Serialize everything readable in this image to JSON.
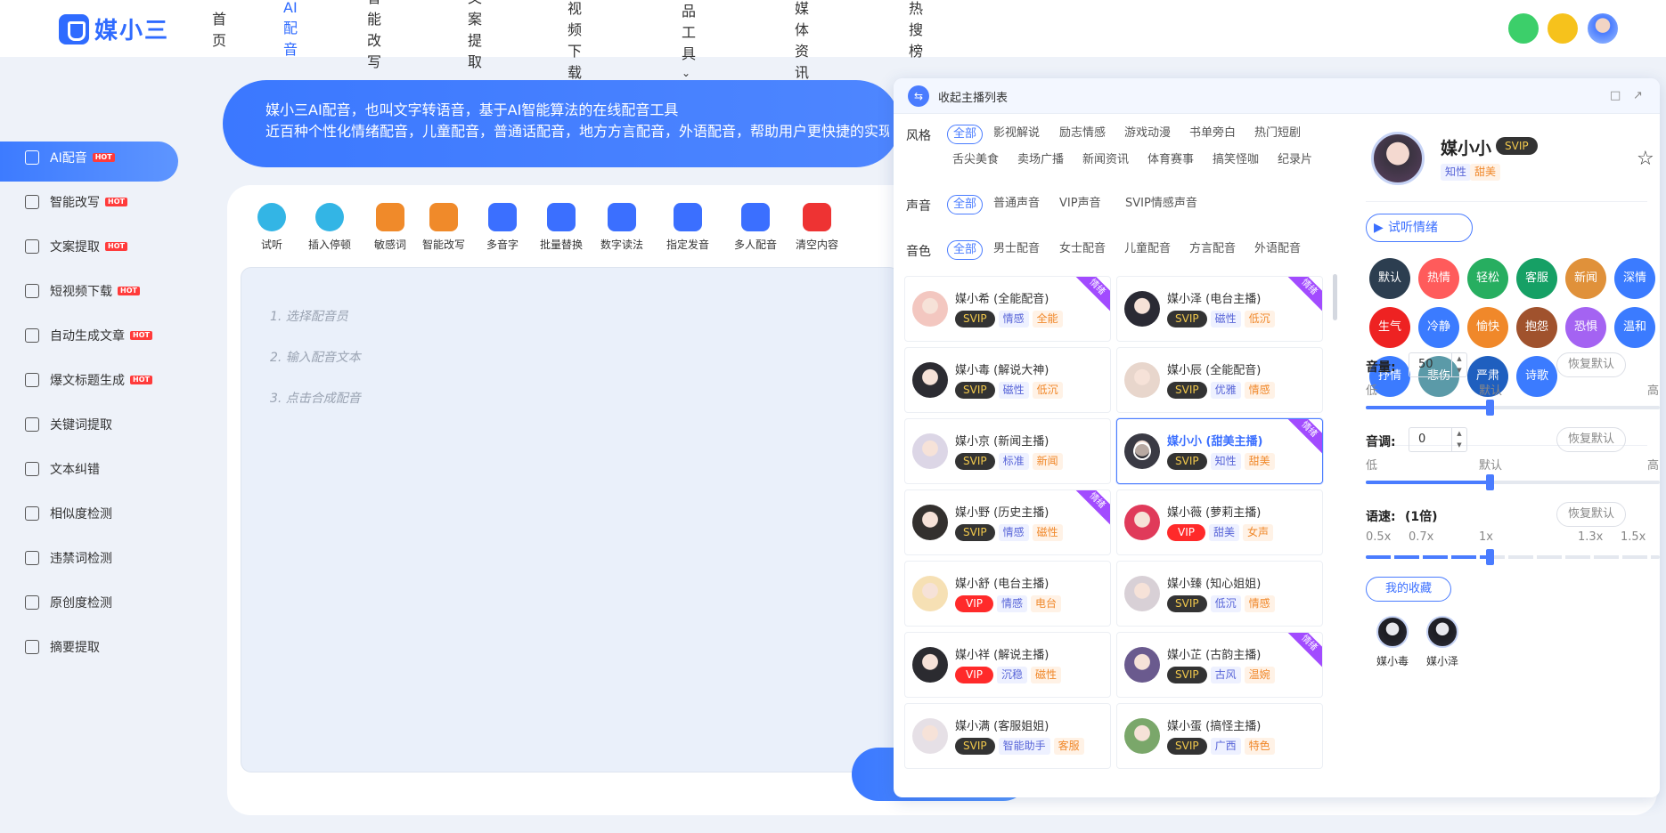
{
  "logo": {
    "text": "媒小三"
  },
  "nav": {
    "items": [
      "首页",
      "AI配音",
      "智能改写",
      "文案提取",
      "短视频下载",
      "精品工具",
      "新媒体资讯",
      "热搜榜"
    ],
    "active_index": 1
  },
  "sidebar": {
    "items": [
      {
        "label": "AI配音",
        "hot": "HOT"
      },
      {
        "label": "智能改写",
        "hot": "HOT"
      },
      {
        "label": "文案提取",
        "hot": "HOT"
      },
      {
        "label": "短视频下载",
        "hot": "HOT"
      },
      {
        "label": "自动生成文章",
        "hot": "HOT"
      },
      {
        "label": "爆文标题生成",
        "hot": "HOT"
      },
      {
        "label": "关键词提取",
        "hot": ""
      },
      {
        "label": "文本纠错",
        "hot": ""
      },
      {
        "label": "相似度检测",
        "hot": ""
      },
      {
        "label": "违禁词检测",
        "hot": ""
      },
      {
        "label": "原创度检测",
        "hot": ""
      },
      {
        "label": "摘要提取",
        "hot": ""
      }
    ],
    "active_index": 0
  },
  "banner": {
    "line1": "媒小三AI配音，也叫文字转语音，基于AI智能算法的在线配音工具",
    "line2": "近百种个性化情绪配音，儿童配音，普通话配音，地方方言配音，外语配音，帮助用户更快捷的实现"
  },
  "toolbar": {
    "items": [
      "试听",
      "插入停顿",
      "敏感词",
      "智能改写",
      "多音字",
      "批量替换",
      "数字读法",
      "指定发音",
      "多人配音",
      "清空内容"
    ]
  },
  "editor": {
    "steps": [
      "1. 选择配音员",
      "2. 输入配音文本",
      "3. 点击合成配音"
    ]
  },
  "panel": {
    "collapse_label": "收起主播列表",
    "filters": {
      "style": {
        "label": "风格",
        "options": [
          "全部",
          "影视解说",
          "励志情感",
          "游戏动漫",
          "书单旁白",
          "热门短剧",
          "舌尖美食",
          "卖场广播",
          "新闻资讯",
          "体育赛事",
          "搞笑怪咖",
          "纪录片"
        ]
      },
      "voice": {
        "label": "声音",
        "options": [
          "全部",
          "普通声音",
          "VIP声音",
          "SVIP情感声音"
        ]
      },
      "timbre": {
        "label": "音色",
        "options": [
          "全部",
          "男士配音",
          "女士配音",
          "儿童配音",
          "方言配音",
          "外语配音"
        ]
      }
    },
    "ribbon_text": "情绪",
    "voices": [
      {
        "name": "媒小希 (全能配音)",
        "level": "SVIP",
        "tags": [
          "情感",
          "全能"
        ],
        "ribbon": true
      },
      {
        "name": "媒小泽 (电台主播)",
        "level": "SVIP",
        "tags": [
          "磁性",
          "低沉"
        ],
        "ribbon": true
      },
      {
        "name": "媒小毒 (解说大神)",
        "level": "SVIP",
        "tags": [
          "磁性",
          "低沉"
        ],
        "ribbon": false
      },
      {
        "name": "媒小辰 (全能配音)",
        "level": "SVIP",
        "tags": [
          "优雅",
          "情感"
        ],
        "ribbon": false
      },
      {
        "name": "媒小京 (新闻主播)",
        "level": "SVIP",
        "tags": [
          "标准",
          "新闻"
        ],
        "ribbon": false
      },
      {
        "name": "媒小小 (甜美主播)",
        "level": "SVIP",
        "tags": [
          "知性",
          "甜美"
        ],
        "ribbon": true,
        "selected": true
      },
      {
        "name": "媒小野 (历史主播)",
        "level": "SVIP",
        "tags": [
          "情感",
          "磁性"
        ],
        "ribbon": true
      },
      {
        "name": "媒小薇 (萝莉主播)",
        "level": "VIP",
        "tags": [
          "甜美",
          "女声"
        ],
        "ribbon": false
      },
      {
        "name": "媒小舒 (电台主播)",
        "level": "VIP",
        "tags": [
          "情感",
          "电台"
        ],
        "ribbon": false
      },
      {
        "name": "媒小臻 (知心姐姐)",
        "level": "SVIP",
        "tags": [
          "低沉",
          "情感"
        ],
        "ribbon": false
      },
      {
        "name": "媒小祥 (解说主播)",
        "level": "VIP",
        "tags": [
          "沉稳",
          "磁性"
        ],
        "ribbon": false
      },
      {
        "name": "媒小芷 (古韵主播)",
        "level": "SVIP",
        "tags": [
          "古风",
          "温婉"
        ],
        "ribbon": true
      },
      {
        "name": "媒小满 (客服姐姐)",
        "level": "SVIP",
        "tags": [
          "智能助手",
          "客服"
        ],
        "ribbon": false
      },
      {
        "name": "媒小蛋 (搞怪主播)",
        "level": "SVIP",
        "tags": [
          "广西",
          "特色"
        ],
        "ribbon": false
      }
    ],
    "profile": {
      "name": "媒小小",
      "level": "SVIP",
      "tags": [
        "知性",
        "甜美"
      ],
      "try_label": "试听情绪"
    },
    "emotions": [
      {
        "label": "默认",
        "color": "#2c3e50"
      },
      {
        "label": "热情",
        "color": "#ff5b5b"
      },
      {
        "label": "轻松",
        "color": "#27ae60"
      },
      {
        "label": "客服",
        "color": "#16a065"
      },
      {
        "label": "新闻",
        "color": "#e0913a"
      },
      {
        "label": "深情",
        "color": "#3b7bff"
      },
      {
        "label": "生气",
        "color": "#ee2222"
      },
      {
        "label": "冷静",
        "color": "#3b7bff"
      },
      {
        "label": "愉快",
        "color": "#f0882a"
      },
      {
        "label": "抱怨",
        "color": "#a0522d"
      },
      {
        "label": "恐惧",
        "color": "#a463f2"
      },
      {
        "label": "温和",
        "color": "#3b7bff"
      },
      {
        "label": "抒情",
        "color": "#3b7bff"
      },
      {
        "label": "悲伤",
        "color": "#5b9aa8"
      },
      {
        "label": "严肃",
        "color": "#1f5fbf"
      },
      {
        "label": "诗歌",
        "color": "#3b7bff"
      }
    ],
    "volume": {
      "label": "音量:",
      "value": "50",
      "reset": "恢复默认",
      "low": "低",
      "mid": "默认",
      "high": "高",
      "level": 0.5
    },
    "pitch": {
      "label": "音调:",
      "value": "0",
      "reset": "恢复默认",
      "low": "低",
      "mid": "默认",
      "high": "高",
      "level": 0.5
    },
    "speed": {
      "label": "语速:",
      "value": "(1倍)",
      "reset": "恢复默认",
      "ticks": [
        "0.5x",
        "0.7x",
        "1x",
        "1.3x",
        "1.5x"
      ],
      "level": 0.5
    },
    "favorites": {
      "label": "我的收藏",
      "items": [
        "媒小毒",
        "媒小泽"
      ]
    }
  }
}
